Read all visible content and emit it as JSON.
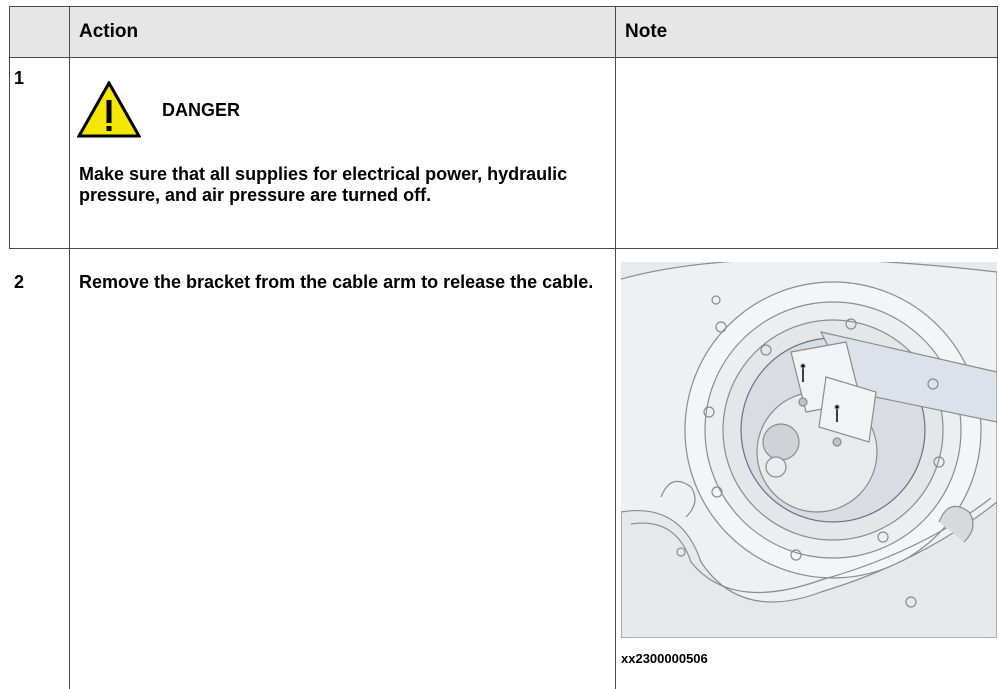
{
  "table": {
    "headers": {
      "action": "Action",
      "note": "Note"
    },
    "rows": [
      {
        "step": "1",
        "warning_level": "DANGER",
        "icon": "warning-triangle-icon",
        "action": "Make sure that all supplies for electrical power, hydraulic pressure, and air pressure are turned off.",
        "note": ""
      },
      {
        "step": "2",
        "action": "Remove the bracket from the cable arm to release the cable.",
        "note_figure_id": "xx2300000506"
      }
    ]
  },
  "colors": {
    "header_bg": "#e6e6e6",
    "warning_yellow": "#f5e600",
    "border": "#4a4a4a"
  }
}
